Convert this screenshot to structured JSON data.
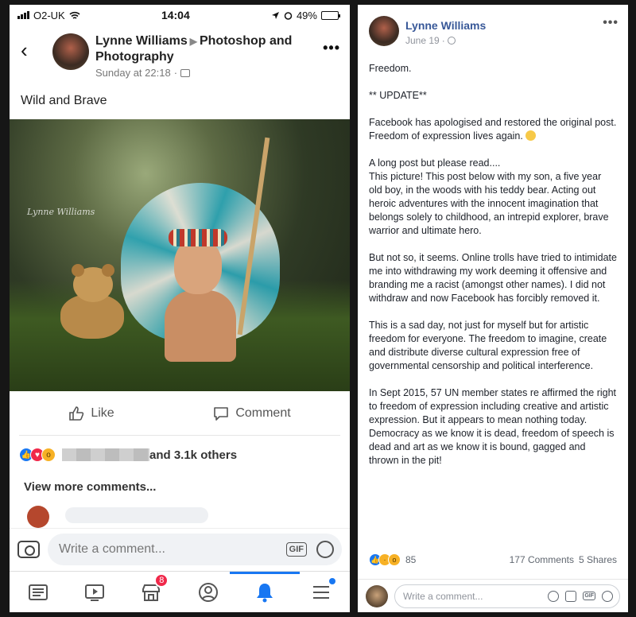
{
  "phone": {
    "status": {
      "carrier": "O2-UK",
      "time": "14:04",
      "battery": "49%",
      "battery_level": 0.49
    },
    "post": {
      "author": "Lynne Williams",
      "group": "Photoshop and Photography",
      "timestamp": "Sunday at 22:18",
      "caption": "Wild and Brave",
      "watermark": "Lynne Williams"
    },
    "actions": {
      "like": "Like",
      "comment": "Comment"
    },
    "reactions": {
      "others": "and 3.1k others"
    },
    "view_more": "View more comments...",
    "composer": {
      "placeholder": "Write a comment...",
      "gif": "GIF"
    },
    "tabbar": {
      "marketplace_badge": "8"
    }
  },
  "desktop": {
    "author": "Lynne Williams",
    "timestamp": "June 19",
    "paragraphs": [
      "Freedom.",
      "** UPDATE**",
      "Facebook has apologised and restored the original post.\nFreedom of expression lives again.",
      "A long post but please read....\nThis picture! This post below with my son, a five year old boy, in the woods with his teddy bear. Acting out heroic adventures with the innocent imagination that belongs solely to childhood, an intrepid explorer, brave warrior and ultimate hero.",
      "But not so, it seems. Online trolls have tried to intimidate me into withdrawing my work deeming it offensive and branding me a racist (amongst other names). I did not withdraw and now Facebook has forcibly removed it.",
      "This is a sad day, not just for myself but for artistic freedom for everyone. The freedom to imagine, create and distribute diverse cultural expression free of governmental censorship and political interference.",
      "In Sept 2015, 57 UN member states re affirmed the right to freedom of expression including creative and artistic expression. But it appears to mean nothing today. Democracy as we know it is dead, freedom of speech is dead and art as we know it is bound, gagged and thrown in the pit!"
    ],
    "reaction_count": "85",
    "comments": "177 Comments",
    "shares": "5 Shares",
    "composer_placeholder": "Write a comment...",
    "gif": "GIF"
  },
  "colors": {
    "fb_blue": "#1877f2",
    "link_blue": "#385898",
    "love_red": "#f0284a",
    "wow_yellow": "#f7b125"
  },
  "icons": {
    "tabbar": [
      "news-feed-icon",
      "watch-icon",
      "marketplace-icon",
      "profile-icon",
      "notifications-bell-icon",
      "menu-icon"
    ]
  }
}
